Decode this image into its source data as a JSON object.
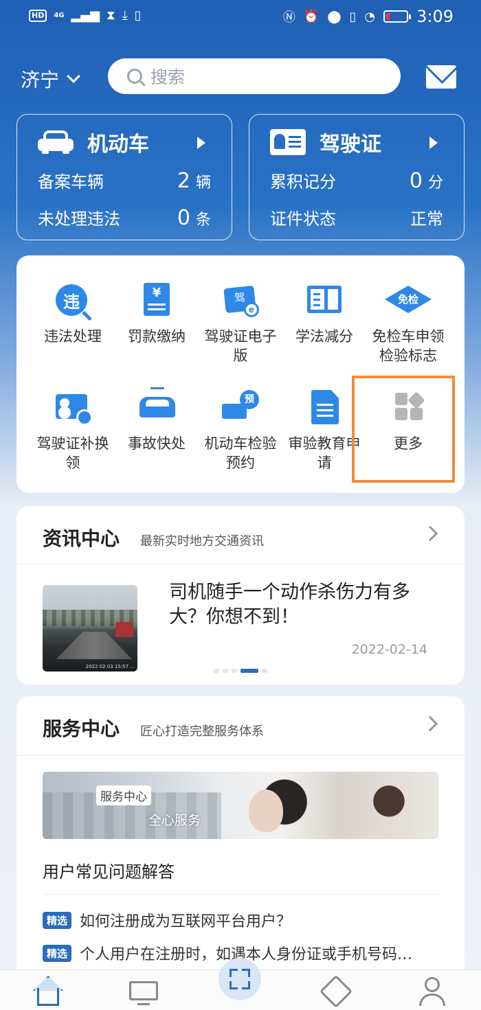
{
  "status_bar": {
    "network_badge": "HD",
    "network_type": "4G",
    "time": "3:09",
    "icons": [
      "signal-icon",
      "hourglass-icon",
      "download-icon",
      "sim-icon",
      "nfc-icon",
      "alarm-icon",
      "location-icon",
      "vibrate-icon",
      "speed-icon",
      "battery-icon"
    ]
  },
  "topbar": {
    "city": "济宁",
    "search_placeholder": "搜索",
    "icons": [
      "chevron-down-icon",
      "search-icon",
      "mail-icon"
    ]
  },
  "vehicle_card": {
    "title": "机动车",
    "rows": [
      {
        "label": "备案车辆",
        "value": "2",
        "unit": "辆"
      },
      {
        "label": "未处理违法",
        "value": "0",
        "unit": "条"
      }
    ]
  },
  "license_card": {
    "title": "驾驶证",
    "rows": [
      {
        "label": "累积记分",
        "value": "0",
        "unit": "分"
      },
      {
        "label": "证件状态",
        "value": "正常",
        "unit": ""
      }
    ]
  },
  "services": [
    {
      "label": "违法处理",
      "icon_text": "违",
      "icon": "violation-icon"
    },
    {
      "label": "罚款缴纳",
      "icon_text": "¥",
      "icon": "receipt-icon"
    },
    {
      "label": "驾驶证电子版",
      "icon_text": "驾",
      "icon": "e-license-icon"
    },
    {
      "label": "学法减分",
      "icon_text": "",
      "icon": "book-icon"
    },
    {
      "label": "免检车申领检验标志",
      "icon_text": "免检",
      "icon": "exempt-icon"
    },
    {
      "label": "驾驶证补换领",
      "icon_text": "",
      "icon": "license-renew-icon"
    },
    {
      "label": "事故快处",
      "icon_text": "",
      "icon": "accident-icon"
    },
    {
      "label": "机动车检验预约",
      "icon_text": "预",
      "icon": "inspection-icon"
    },
    {
      "label": "审验教育申请",
      "icon_text": "",
      "icon": "document-icon"
    },
    {
      "label": "更多",
      "icon_text": "",
      "icon": "more-grid-icon"
    }
  ],
  "news": {
    "title": "资讯中心",
    "subtitle": "最新实时地方交通资讯",
    "headline": "司机随手一个动作杀伤力有多大？你想不到！",
    "date": "2022-02-14",
    "image_stamp": "2022 02 03  15:57 ...",
    "carousel": {
      "count": 5,
      "active": 3
    }
  },
  "service_center": {
    "title": "服务中心",
    "subtitle": "匠心打造完整服务体系",
    "banner_tag": "服务中心",
    "banner_subtitle": "全心服务",
    "faq_heading": "用户常见问题解答",
    "faq": [
      {
        "tag": "精选",
        "text": "如何注册成为互联网平台用户？"
      },
      {
        "tag": "精选",
        "text": "个人用户在注册时，如遇本人身份证或手机号码…"
      }
    ]
  },
  "bottom_nav": [
    {
      "name": "home",
      "icon": "home-icon",
      "active": true
    },
    {
      "name": "online",
      "icon": "monitor-icon",
      "active": false
    },
    {
      "name": "scan",
      "icon": "scan-icon",
      "active": false
    },
    {
      "name": "service",
      "icon": "handshake-icon",
      "active": false
    },
    {
      "name": "profile",
      "icon": "user-icon",
      "active": false
    }
  ],
  "colors": {
    "primary": "#2a6cc0",
    "icon_blue": "#2e88e8",
    "highlight": "#f28c3a"
  }
}
